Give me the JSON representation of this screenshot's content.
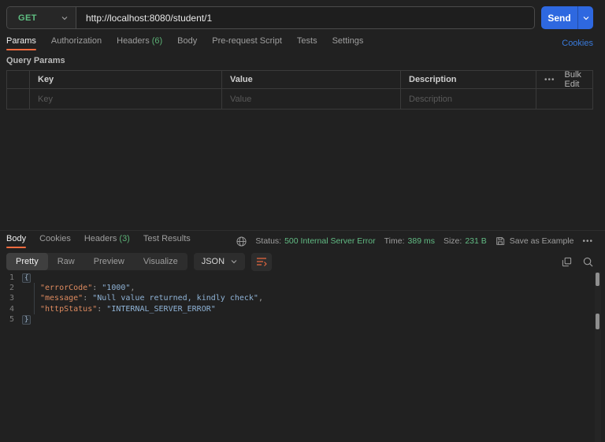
{
  "request": {
    "method": "GET",
    "url": "http://localhost:8080/student/1",
    "send_label": "Send",
    "cookies_link": "Cookies",
    "tabs": [
      {
        "label": "Params",
        "active": true
      },
      {
        "label": "Authorization"
      },
      {
        "label": "Headers",
        "count": "(6)"
      },
      {
        "label": "Body"
      },
      {
        "label": "Pre-request Script"
      },
      {
        "label": "Tests"
      },
      {
        "label": "Settings"
      }
    ]
  },
  "params": {
    "section_title": "Query Params",
    "columns": {
      "key": "Key",
      "value": "Value",
      "description": "Description"
    },
    "row_placeholders": {
      "key": "Key",
      "value": "Value",
      "description": "Description"
    },
    "bulk_edit": "Bulk Edit",
    "more": "•••"
  },
  "response": {
    "tabs": [
      {
        "label": "Body",
        "active": true
      },
      {
        "label": "Cookies"
      },
      {
        "label": "Headers",
        "count": "(3)"
      },
      {
        "label": "Test Results"
      }
    ],
    "meta": {
      "status_label": "Status:",
      "status_value": "500 Internal Server Error",
      "time_label": "Time:",
      "time_value": "389 ms",
      "size_label": "Size:",
      "size_value": "231 B",
      "save_as_example": "Save as Example",
      "more": "•••"
    },
    "view_tabs": [
      {
        "label": "Pretty",
        "active": true
      },
      {
        "label": "Raw"
      },
      {
        "label": "Preview"
      },
      {
        "label": "Visualize"
      }
    ],
    "language": "JSON",
    "body": {
      "lines": [
        {
          "num": 1,
          "indent": 0,
          "tokens": [
            {
              "text": "{",
              "type": "brace"
            }
          ]
        },
        {
          "num": 2,
          "indent": 4,
          "tokens": [
            {
              "text": "\"errorCode\"",
              "type": "key"
            },
            {
              "text": ": ",
              "type": "punc"
            },
            {
              "text": "\"1000\"",
              "type": "string"
            },
            {
              "text": ",",
              "type": "punc"
            }
          ]
        },
        {
          "num": 3,
          "indent": 4,
          "tokens": [
            {
              "text": "\"message\"",
              "type": "key"
            },
            {
              "text": ": ",
              "type": "punc"
            },
            {
              "text": "\"Null value returned, kindly check\"",
              "type": "string"
            },
            {
              "text": ",",
              "type": "punc"
            }
          ]
        },
        {
          "num": 4,
          "indent": 4,
          "tokens": [
            {
              "text": "\"httpStatus\"",
              "type": "key"
            },
            {
              "text": ": ",
              "type": "punc"
            },
            {
              "text": "\"INTERNAL_SERVER_ERROR\"",
              "type": "string"
            }
          ]
        },
        {
          "num": 5,
          "indent": 0,
          "tokens": [
            {
              "text": "}",
              "type": "brace"
            }
          ]
        }
      ]
    }
  },
  "colors": {
    "accent_orange": "#f26b3f",
    "method_green": "#5fbf82",
    "status_green": "#61ba83",
    "send_blue": "#2e68e0",
    "link_blue": "#3a7bdd",
    "json_key": "#dd8a5f",
    "json_string": "#8fb3d6"
  }
}
